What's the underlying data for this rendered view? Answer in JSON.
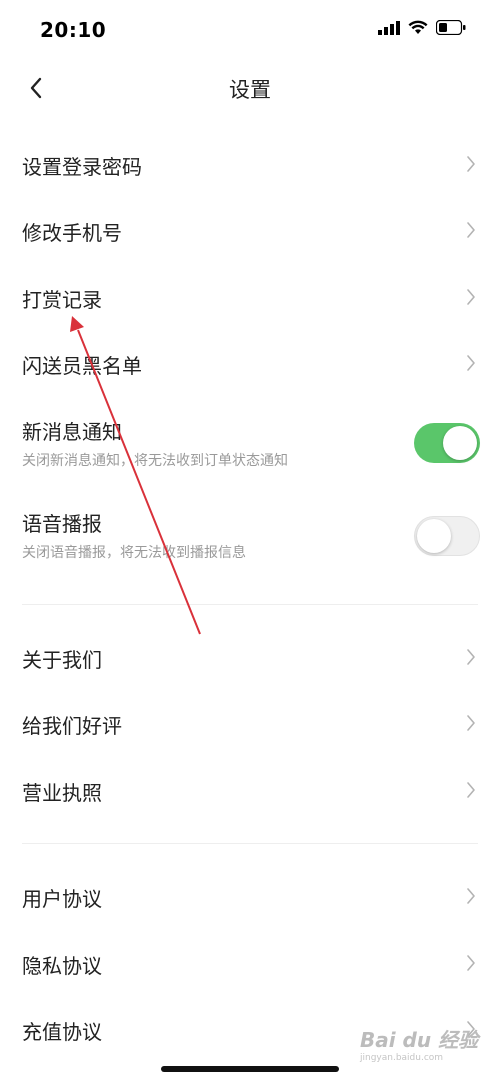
{
  "status_bar": {
    "time": "20:10"
  },
  "nav": {
    "title": "设置"
  },
  "colors": {
    "toggle_on": "#5ac66a",
    "arrow": "#d9313a"
  },
  "group1": [
    {
      "label": "设置登录密码"
    },
    {
      "label": "修改手机号"
    },
    {
      "label": "打赏记录"
    },
    {
      "label": "闪送员黑名单"
    }
  ],
  "notify": {
    "label": "新消息通知",
    "subtitle": "关闭新消息通知，将无法收到订单状态通知",
    "enabled": true
  },
  "voice": {
    "label": "语音播报",
    "subtitle": "关闭语音播报，将无法收到播报信息",
    "enabled": false
  },
  "group2": [
    {
      "label": "关于我们"
    },
    {
      "label": "给我们好评"
    },
    {
      "label": "营业执照"
    }
  ],
  "group3": [
    {
      "label": "用户协议"
    },
    {
      "label": "隐私协议"
    },
    {
      "label": "充值协议"
    }
  ],
  "watermark": {
    "brand": "Bai du 经验",
    "url": "jingyan.baidu.com"
  }
}
